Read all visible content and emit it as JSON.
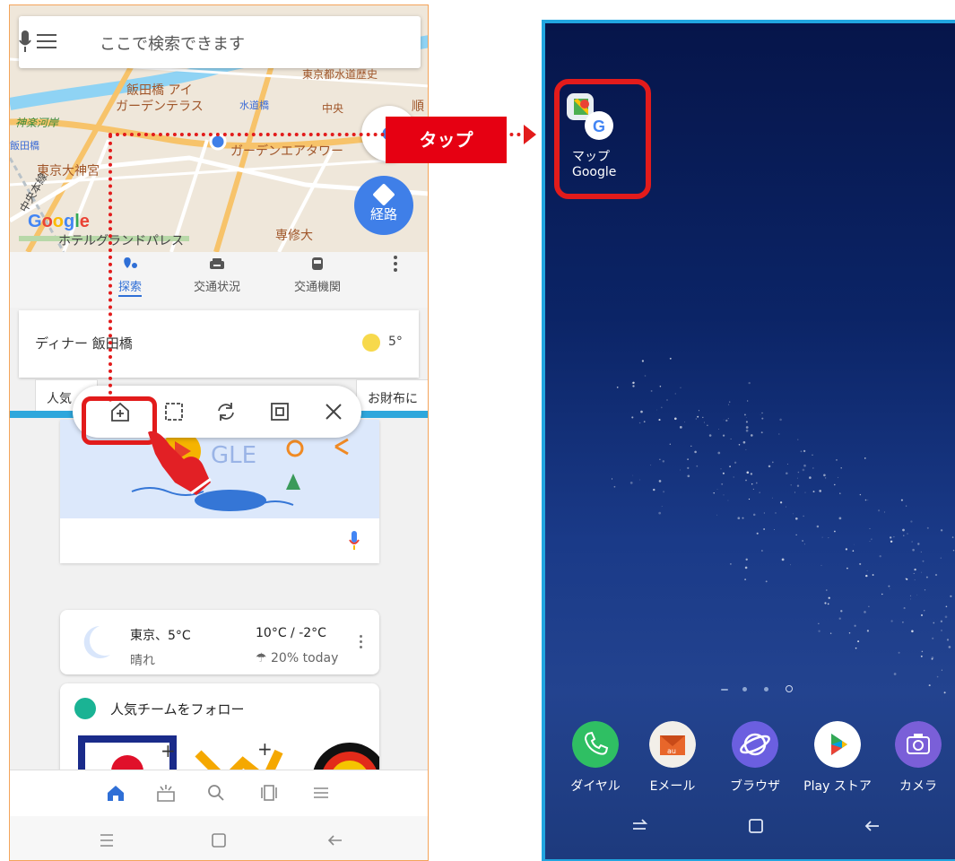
{
  "left_phone": {
    "search_placeholder": "ここで検索できます",
    "map_labels": {
      "iidabashi_garden_1": "飯田橋 アイ",
      "iidabashi_garden_2": "ガーデンテラス",
      "suidobashi": "水道橋",
      "kagurakawagishi": "神楽河岸",
      "iidabashi_station": "飯田橋",
      "garden_air_tower": "ガーデンエアタワー",
      "tokyo_daijingu": "東京大神宮",
      "hotel_grand_palace": "ホテルグランドパレス",
      "senshu_univ": "専修大",
      "tokyo_water": "東京都水道歴史",
      "chuo": "中央",
      "jun": "順",
      "chuo_line": "中央本線"
    },
    "google_logo": "Google",
    "route_button": "経路",
    "tabs": [
      {
        "label": "探索",
        "icon": "explore-icon"
      },
      {
        "label": "交通状況",
        "icon": "car-icon"
      },
      {
        "label": "交通機関",
        "icon": "bus-icon"
      }
    ],
    "dinner_card": {
      "text": "ディナー 飯田橋",
      "temp": "5°"
    },
    "card_tabs": {
      "popular": "人気",
      "wallet": "お財布に"
    },
    "weather": {
      "location": "東京、5°C",
      "range": "10°C / -2°C",
      "condition": "晴れ",
      "rain": "20% today"
    },
    "team_card": {
      "title": "人気チームをフォロー"
    }
  },
  "annotation": {
    "tap_label": "タップ"
  },
  "right_phone": {
    "app": {
      "label_line1": "マップ",
      "label_line2": "Google"
    },
    "dock": [
      {
        "label": "ダイヤル",
        "icon": "phone-icon",
        "color": "#2fbf63"
      },
      {
        "label": "Eメール",
        "icon": "email-icon",
        "color": "#f2efe9"
      },
      {
        "label": "ブラウザ",
        "icon": "browser-icon",
        "color": "#6b5fe0"
      },
      {
        "label": "Play ストア",
        "icon": "play-store-icon",
        "color": "#ffffff"
      },
      {
        "label": "カメラ",
        "icon": "camera-icon",
        "color": "#7a5fd8"
      }
    ]
  },
  "colors": {
    "annotation_red": "#e21b1b",
    "divider_blue": "#2ea7dc",
    "accent_blue": "#3f7fe8"
  }
}
